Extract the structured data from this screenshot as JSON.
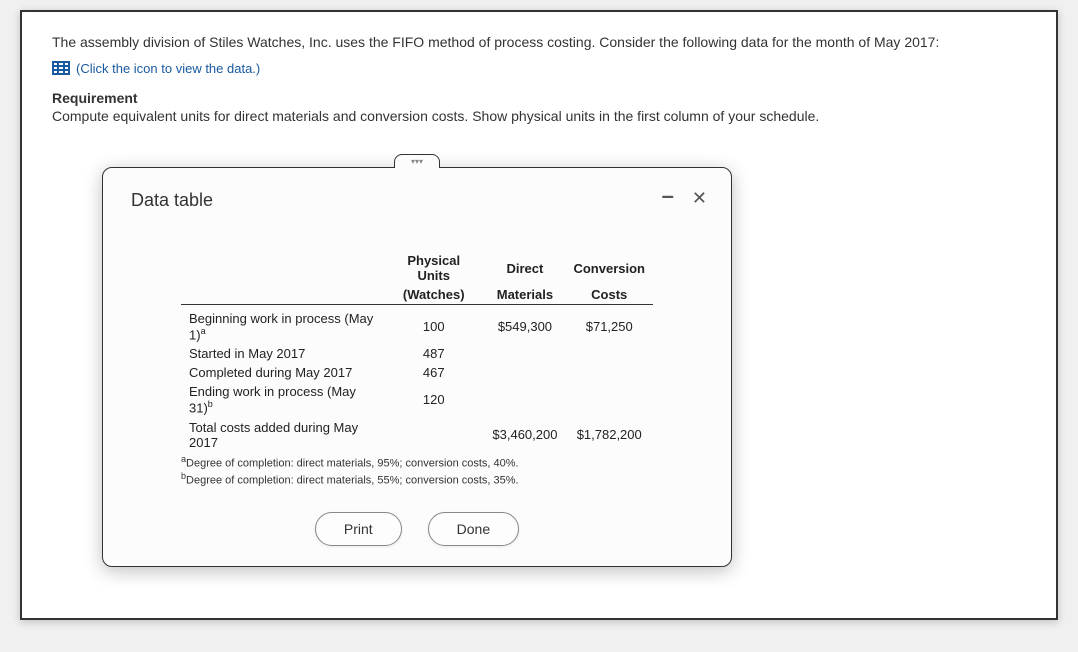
{
  "problem": {
    "intro": "The assembly division of Stiles Watches, Inc. uses the FIFO method of process costing. Consider the following data for the month of May 2017:",
    "link_text": "(Click the icon to view the data.)"
  },
  "requirement": {
    "heading": "Requirement",
    "body": "Compute equivalent units for direct materials and conversion costs. Show physical units in the first column of your schedule."
  },
  "modal": {
    "title": "Data table",
    "tab_marker": "▾▾▾",
    "min_label": "–",
    "close_label": "✕",
    "headers": {
      "col1_top": "Physical Units",
      "col1_sub": "(Watches)",
      "col2_top": "Direct",
      "col2_sub": "Materials",
      "col3_top": "Conversion",
      "col3_sub": "Costs"
    },
    "rows": {
      "r1_label": "Beginning work in process (May 1)",
      "r1_sup": "a",
      "r1_units": "100",
      "r1_dm": "$549,300",
      "r1_cc": "$71,250",
      "r2_label": "Started in May 2017",
      "r2_units": "487",
      "r3_label": "Completed during May 2017",
      "r3_units": "467",
      "r4_label": "Ending work in process (May 31)",
      "r4_sup": "b",
      "r4_units": "120",
      "r5_label": "Total costs added during May 2017",
      "r5_dm": "$3,460,200",
      "r5_cc": "$1,782,200"
    },
    "footnotes": {
      "a_sup": "a",
      "a": "Degree of completion: direct materials, 95%; conversion costs, 40%.",
      "b_sup": "b",
      "b": "Degree of completion: direct materials, 55%; conversion costs, 35%."
    },
    "buttons": {
      "print": "Print",
      "done": "Done"
    }
  }
}
